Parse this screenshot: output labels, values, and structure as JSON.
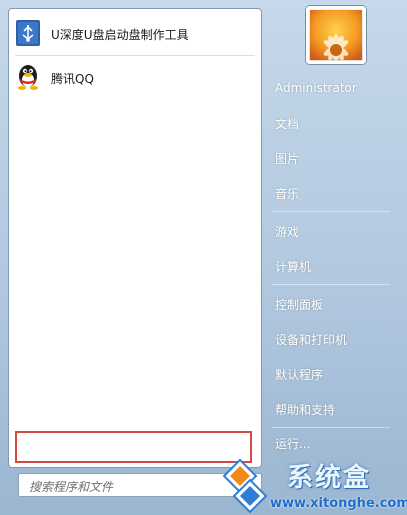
{
  "programs": [
    {
      "label": "U深度U盘启动盘制作工具",
      "icon": "usb-drive-icon"
    },
    {
      "label": "腾讯QQ",
      "icon": "qq-penguin-icon"
    }
  ],
  "search": {
    "placeholder": "搜索程序和文件"
  },
  "user": {
    "name": "Administrator",
    "avatar": "flower-avatar"
  },
  "right_menu": [
    "文档",
    "图片",
    "音乐",
    "游戏",
    "计算机",
    "控制面板",
    "设备和打印机",
    "默认程序",
    "帮助和支持",
    "运行..."
  ],
  "watermark": {
    "brand": "系统盒",
    "url": "www.xitonghe.com"
  },
  "colors": {
    "highlight_box": "#d04a4a",
    "menu_text": "#ffffff",
    "watermark_blue": "#1f6fc8"
  }
}
